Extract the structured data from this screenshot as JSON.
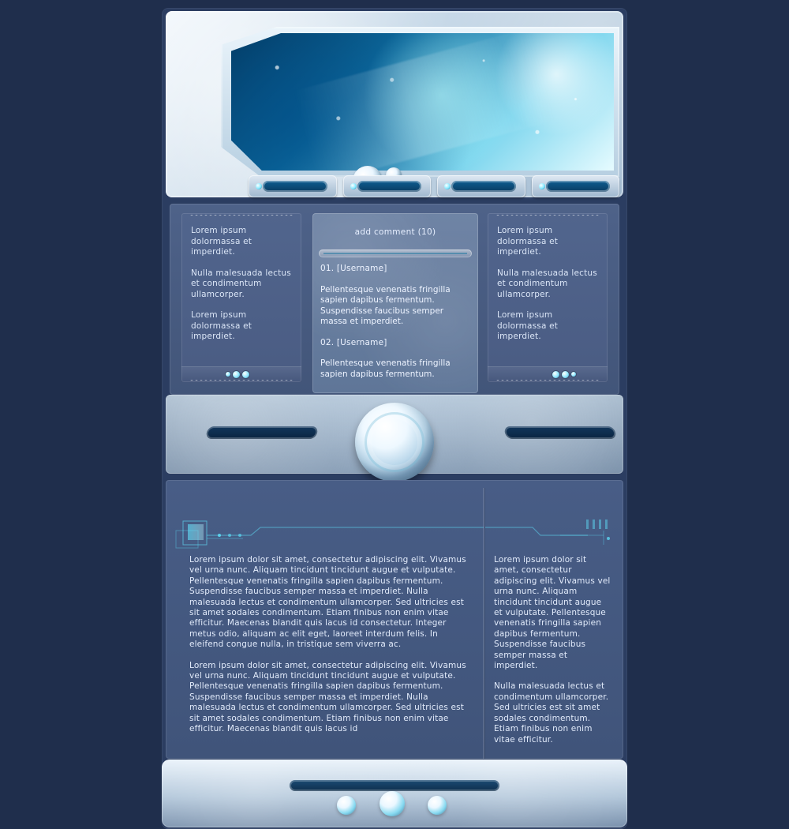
{
  "header": {
    "nav_tabs": [
      "",
      "",
      "",
      ""
    ]
  },
  "upper": {
    "left_card": {
      "paragraphs": [
        "Lorem ipsum dolormassa et imperdiet.",
        "Nulla malesuada lectus et condimentum ullamcorper.",
        "Lorem ipsum dolormassa et imperdiet."
      ]
    },
    "center_card": {
      "add_comment_label": "add comment (10)",
      "comments": [
        {
          "username": "01. [Username]",
          "text": "Pellentesque venenatis fringilla sapien dapibus fermentum. Suspendisse faucibus semper massa et imperdiet."
        },
        {
          "username": "02. [Username]",
          "text": "Pellentesque venenatis fringilla sapien dapibus fermentum."
        }
      ]
    },
    "right_card": {
      "paragraphs": [
        "Lorem ipsum dolormassa et imperdiet.",
        "Nulla malesuada lectus et condimentum ullamcorper.",
        "Lorem ipsum dolormassa et imperdiet."
      ]
    }
  },
  "main": {
    "left_paragraphs": [
      "Lorem ipsum dolor sit amet, consectetur adipiscing elit. Vivamus vel urna nunc. Aliquam tincidunt tincidunt augue et vulputate. Pellentesque venenatis fringilla sapien dapibus fermentum. Suspendisse faucibus semper massa et imperdiet. Nulla malesuada lectus et condimentum ullamcorper. Sed ultricies est sit amet sodales condimentum. Etiam finibus non enim vitae efficitur. Maecenas blandit quis lacus id consectetur. Integer metus odio, aliquam ac elit eget, laoreet interdum felis. In eleifend congue nulla, in tristique sem viverra ac.",
      "Lorem ipsum dolor sit amet, consectetur adipiscing elit. Vivamus vel urna nunc. Aliquam tincidunt tincidunt augue et vulputate. Pellentesque venenatis fringilla sapien dapibus fermentum. Suspendisse faucibus semper massa et imperdiet. Nulla malesuada lectus et condimentum ullamcorper. Sed ultricies est sit amet sodales condimentum. Etiam finibus non enim vitae efficitur. Maecenas blandit quis lacus id"
    ],
    "right_paragraphs": [
      "Lorem ipsum dolor sit amet, consectetur adipiscing elit. Vivamus vel urna nunc. Aliquam tincidunt tincidunt augue et vulputate. Pellentesque venenatis fringilla sapien dapibus fermentum. Suspendisse faucibus semper massa et imperdiet.",
      "Nulla malesuada lectus et condimentum ullamcorper. Sed ultricies est sit amet sodales condimentum. Etiam finibus non enim vitae efficitur."
    ]
  },
  "theme": {
    "background": "#1f2e4c",
    "panel": "#485d86",
    "accent": "#86e9ff",
    "text": "#e2ebfb"
  },
  "icons": {
    "header_orbs": "orb-icon",
    "nav_dot": "indicator-dot-icon",
    "pager_dots": "pager-dots-icon",
    "center_orb": "center-orb-icon",
    "footer_orbs": "footer-orb-icon"
  }
}
